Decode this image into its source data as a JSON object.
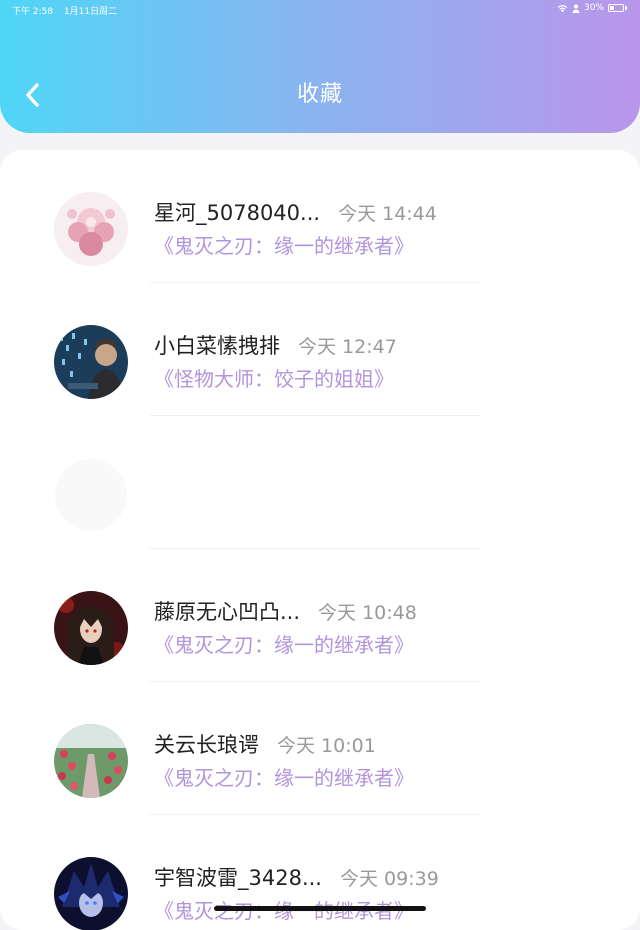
{
  "status_bar": {
    "time": "下午 2:58",
    "date": "1月11日周二",
    "battery": "30%"
  },
  "header": {
    "title": "收藏"
  },
  "favorites": [
    {
      "name": "星河_5078040...",
      "time": "今天 14:44",
      "work": "《鬼灭之刃：缘一的继承者》",
      "avatar": "pink-flower-girl-avatar"
    },
    {
      "name": "小白菜愫拽排",
      "time": "今天 12:47",
      "work": "《怪物大师：饺子的姐姐》",
      "avatar": "hacker-man-avatar"
    },
    {
      "name": "",
      "time": "",
      "work": "",
      "avatar": "blank-avatar"
    },
    {
      "name": "藤原无心凹凸...",
      "time": "今天 10:48",
      "work": "《鬼灭之刃：缘一的继承者》",
      "avatar": "dark-hair-boy-avatar"
    },
    {
      "name": "关云长琅谔",
      "time": "今天 10:01",
      "work": "《鬼灭之刃：缘一的继承者》",
      "avatar": "rose-garden-avatar"
    },
    {
      "name": "宇智波雷_3428...",
      "time": "今天 09:39",
      "work": "《鬼灭之刃：缘一的继承者》",
      "avatar": "blue-anime-boy-avatar"
    }
  ]
}
